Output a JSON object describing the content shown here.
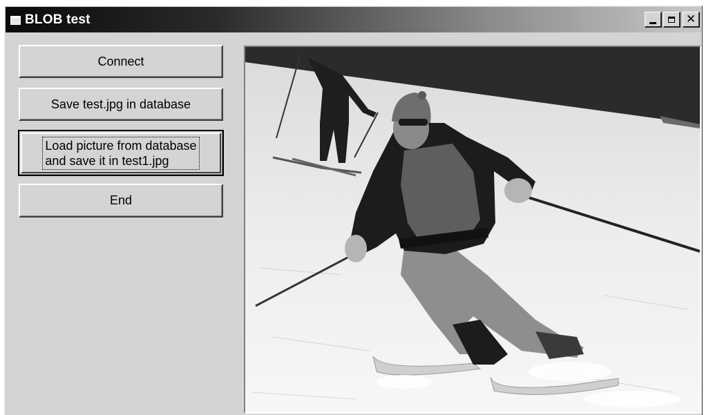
{
  "window": {
    "title": "BLOB test",
    "icon": "app-window-icon",
    "controls": {
      "minimize": "minimize-icon",
      "maximize": "maximize-icon",
      "close": "close-icon"
    }
  },
  "buttons": {
    "connect": "Connect",
    "save": "Save test.jpg in database",
    "load": "Load picture from database\nand save it in test1.jpg",
    "end": "End"
  },
  "picture": {
    "description_icon": "skier-photo"
  },
  "colors": {
    "face": "#d4d4d4",
    "title_start": "#0a0a0a",
    "title_end": "#c8c8c8"
  }
}
